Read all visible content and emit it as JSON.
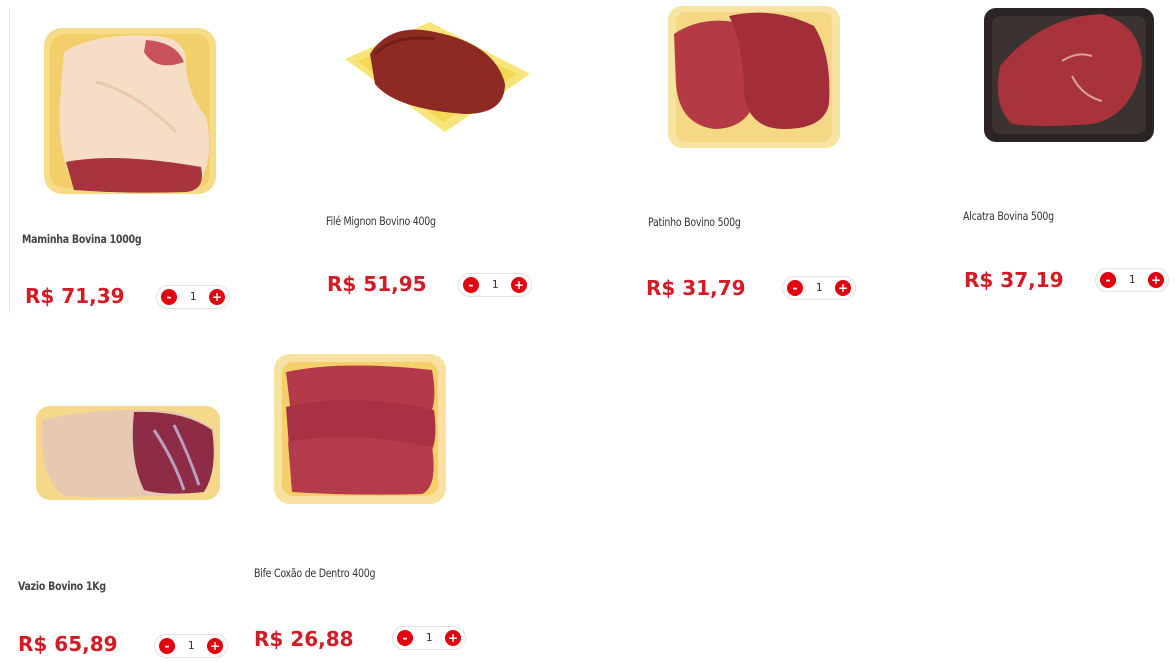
{
  "products": [
    {
      "name": "Maminha Bovina 1000g",
      "price": "R$ 71,39",
      "quantity": "1",
      "image": "maminha-bovina-image",
      "minus": "-",
      "plus": "+"
    },
    {
      "name": "Filé Mignon Bovino 400g",
      "price": "R$ 51,95",
      "quantity": "1",
      "image": "file-mignon-image",
      "minus": "-",
      "plus": "+"
    },
    {
      "name": "Patinho Bovino 500g",
      "price": "R$ 31,79",
      "quantity": "1",
      "image": "patinho-bovino-image",
      "minus": "-",
      "plus": "+"
    },
    {
      "name": "Alcatra Bovina 500g",
      "price": "R$ 37,19",
      "quantity": "1",
      "image": "alcatra-bovina-image",
      "minus": "-",
      "plus": "+"
    },
    {
      "name": "Vazio Bovino 1Kg",
      "price": "R$ 65,89",
      "quantity": "1",
      "image": "vazio-bovino-image",
      "minus": "-",
      "plus": "+"
    },
    {
      "name": "Bife Coxão de Dentro 400g",
      "price": "R$ 26,88",
      "quantity": "1",
      "image": "bife-coxao-image",
      "minus": "-",
      "plus": "+"
    }
  ],
  "colors": {
    "price": "#d21b24",
    "button": "#e3000f",
    "tray": "#f7d98c"
  }
}
